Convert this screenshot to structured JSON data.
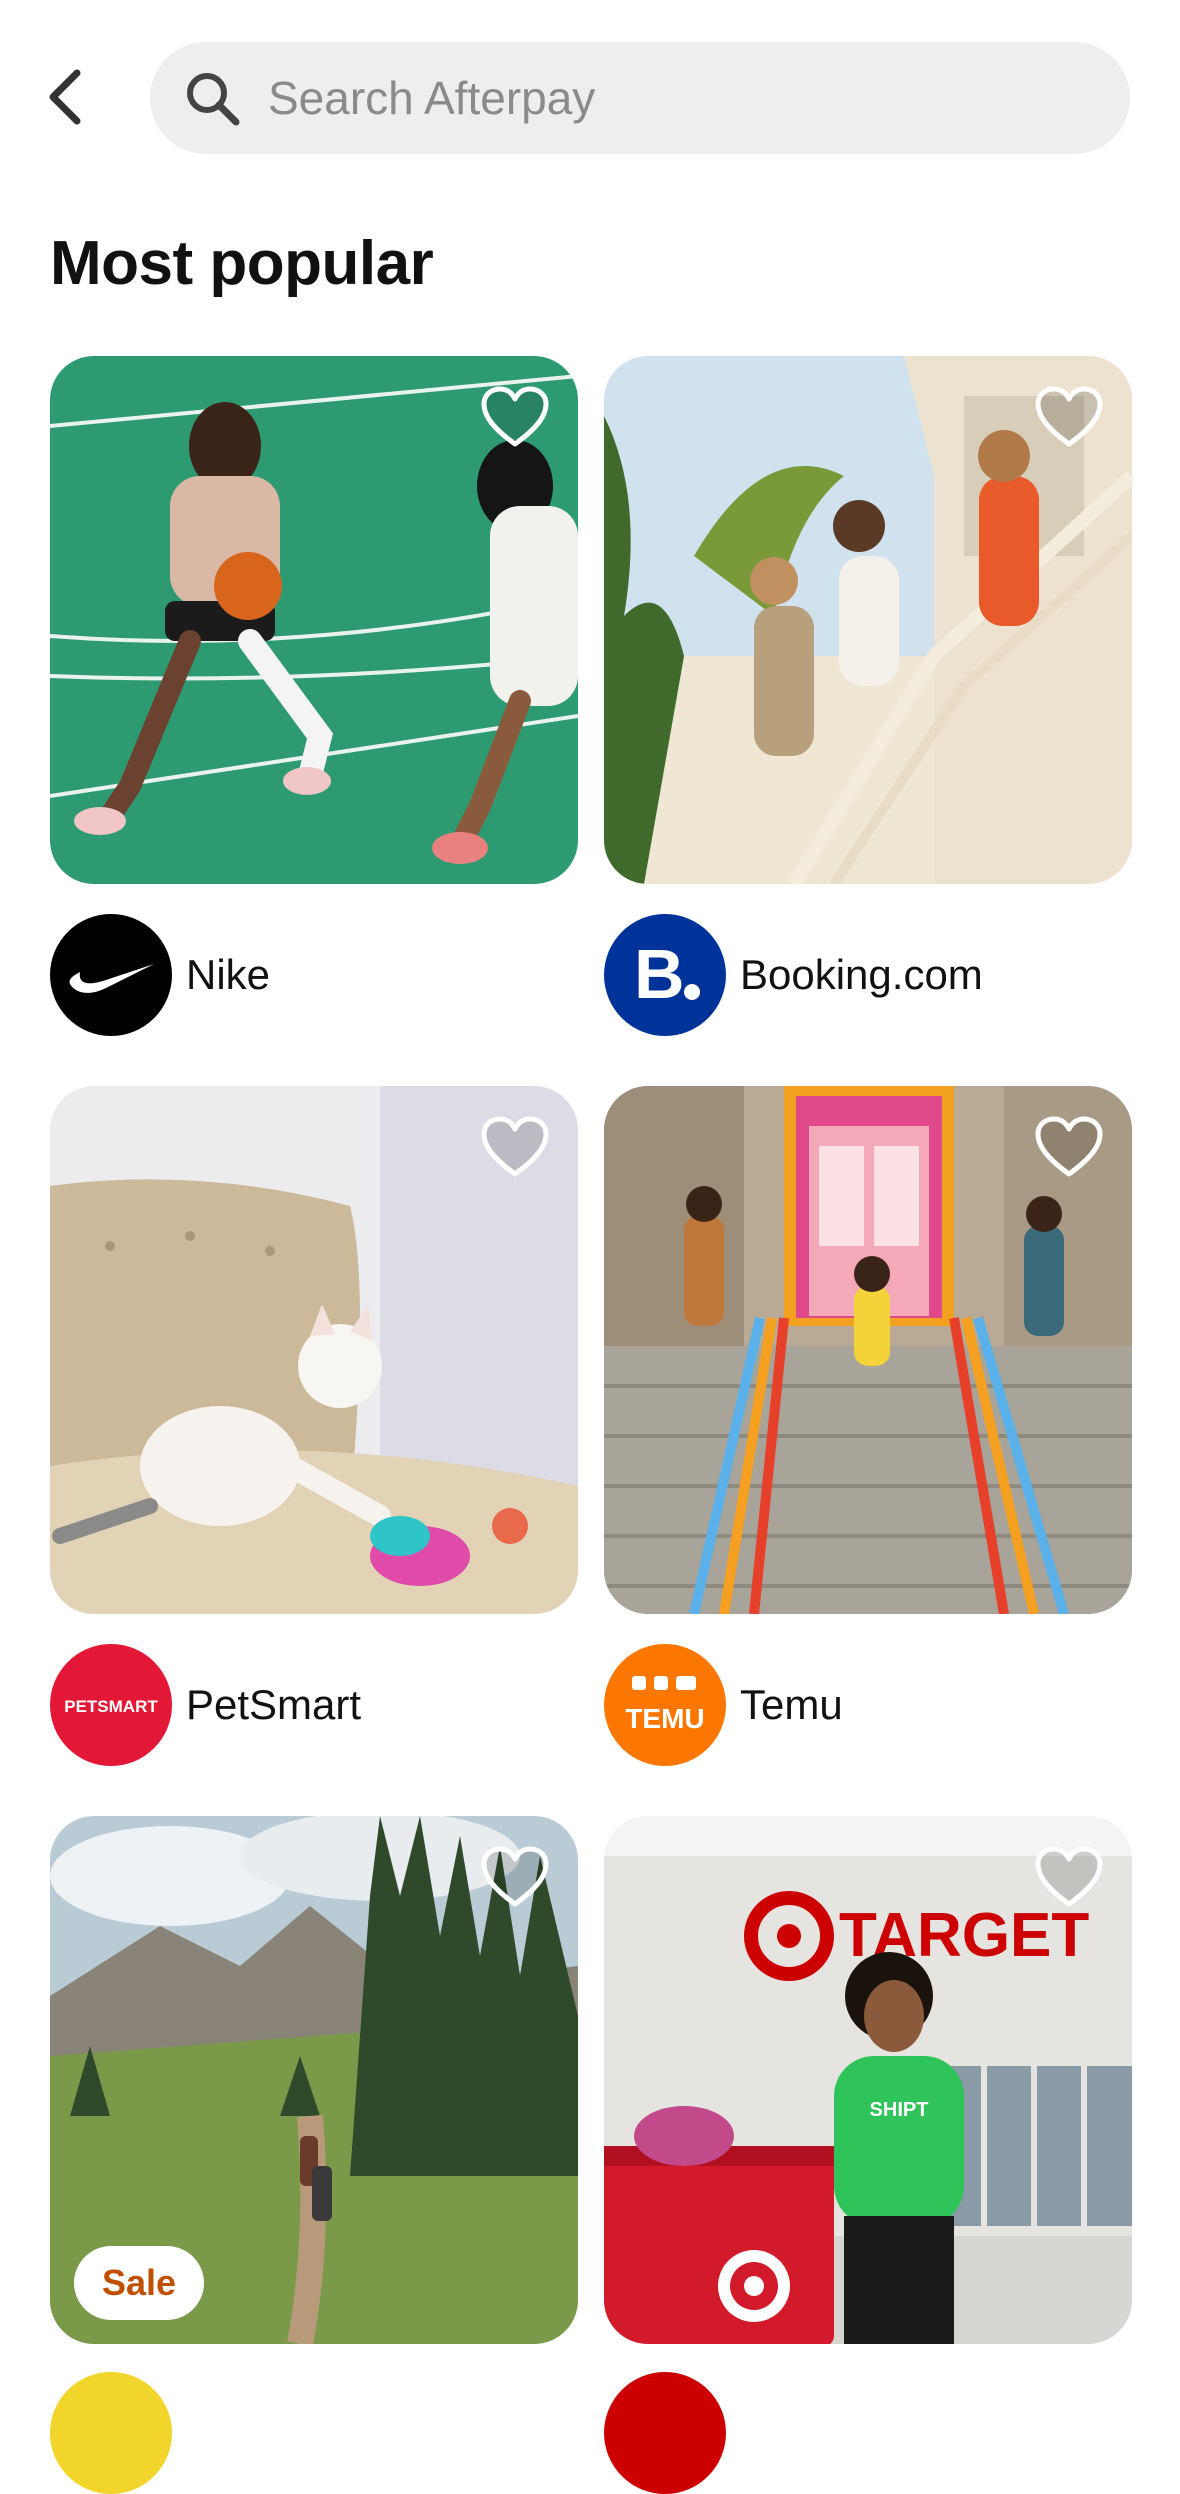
{
  "search": {
    "placeholder": "Search Afterpay"
  },
  "section": {
    "title": "Most popular"
  },
  "cards": [
    {
      "merchant": "Nike"
    },
    {
      "merchant": "Booking.com"
    },
    {
      "merchant": "PetSmart",
      "logo_text": "PETSMART"
    },
    {
      "merchant": "Temu",
      "logo_text": "TEMU"
    },
    {
      "badge": "Sale"
    },
    {
      "sign_text": "TARGET",
      "shirt_text": "SHIPT"
    }
  ],
  "colors": {
    "search_bg": "#eeeeee",
    "nike_logo": "#000000",
    "booking_logo": "#003399",
    "petsmart_logo": "#e31837",
    "temu_logo": "#fb7701",
    "sale_text": "#c05000",
    "target_red": "#cc0000"
  },
  "icons": [
    "back-chevron-icon",
    "search-icon",
    "heart-outline-icon",
    "nike-swoosh-logo",
    "booking-b-logo",
    "petsmart-logo",
    "temu-logo"
  ]
}
